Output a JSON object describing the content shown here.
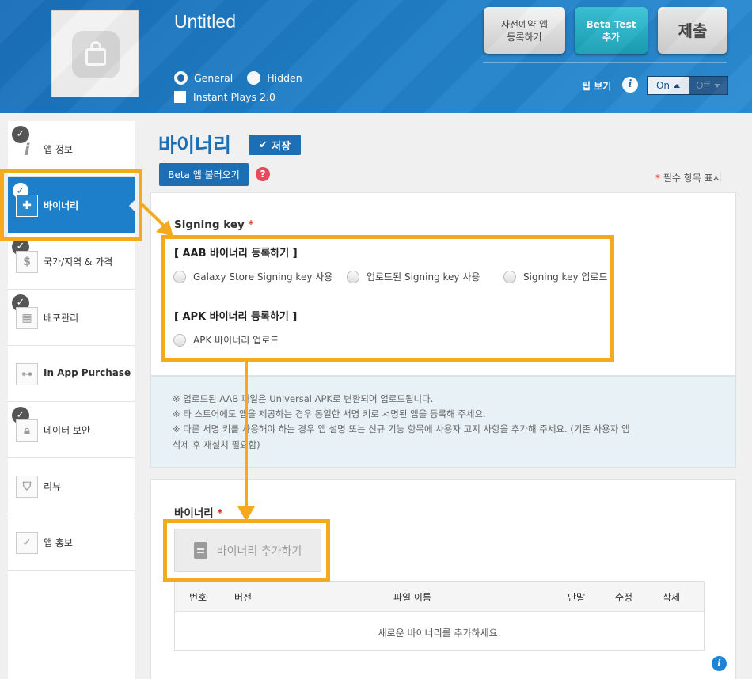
{
  "header": {
    "app_title": "Untitled",
    "buttons": {
      "preorder": "사전예약 앱\n등록하기",
      "beta_test": "Beta Test\n추가",
      "submit": "제출"
    },
    "visibility": {
      "general": "General",
      "hidden": "Hidden",
      "selected": "General"
    },
    "instant_plays": "Instant Plays 2.0",
    "tip_label": "팁 보기",
    "toggle": {
      "on": "On",
      "off": "Off",
      "state": "On"
    }
  },
  "sidebar": {
    "items": [
      {
        "label": "앱 정보",
        "checked": true,
        "icon": "info-icon"
      },
      {
        "label": "바이너리",
        "checked": true,
        "active": true,
        "icon": "binary-icon"
      },
      {
        "label": "국가/지역 & 가격",
        "checked": true,
        "icon": "dollar-icon"
      },
      {
        "label": "배포관리",
        "checked": true,
        "icon": "calendar-icon"
      },
      {
        "label": "In App Purchase",
        "checked": false,
        "icon": "network-icon"
      },
      {
        "label": "데이터 보안",
        "checked": true,
        "icon": "lock-icon"
      },
      {
        "label": "리뷰",
        "checked": false,
        "icon": "shield-icon"
      },
      {
        "label": "앱 홍보",
        "checked": false,
        "icon": "promo-icon"
      }
    ]
  },
  "main": {
    "title": "바이너리",
    "save": "저장",
    "beta_load": "Beta 앱 불러오기",
    "required_note": "필수 항목 표시",
    "signing_key": {
      "label": "Signing key",
      "aab_heading": "[ AAB 바이너리 등록하기 ]",
      "aab_options": [
        "Galaxy Store Signing key 사용",
        "업로드된 Signing key 사용",
        "Signing key 업로드"
      ],
      "apk_heading": "[ APK 바이너리 등록하기 ]",
      "apk_options": [
        "APK 바이너리 업로드"
      ]
    },
    "notes": [
      "※ 업로드된 AAB 파일은 Universal APK로 변환되어 업로드됩니다.",
      "※ 타 스토어에도 앱을 제공하는 경우 동일한 서명 키로 서명된 앱을 등록해 주세요.",
      "※ 다른 서명 키를 사용해야 하는 경우 앱 설명 또는 신규 기능 항목에 사용자 고지 사항을 추가해 주세요. (기존 사용자 앱",
      "삭제 후 재설치 필요함)"
    ],
    "binary": {
      "label": "바이너리",
      "add_button": "바이너리 추가하기",
      "columns": [
        "번호",
        "버전",
        "파일 이름",
        "단말",
        "수정",
        "삭제"
      ],
      "empty": "새로운 바이너리를 추가하세요."
    }
  },
  "colors": {
    "accent": "#1d6fb5",
    "highlight": "#f5a91c",
    "required": "#e0301e"
  }
}
